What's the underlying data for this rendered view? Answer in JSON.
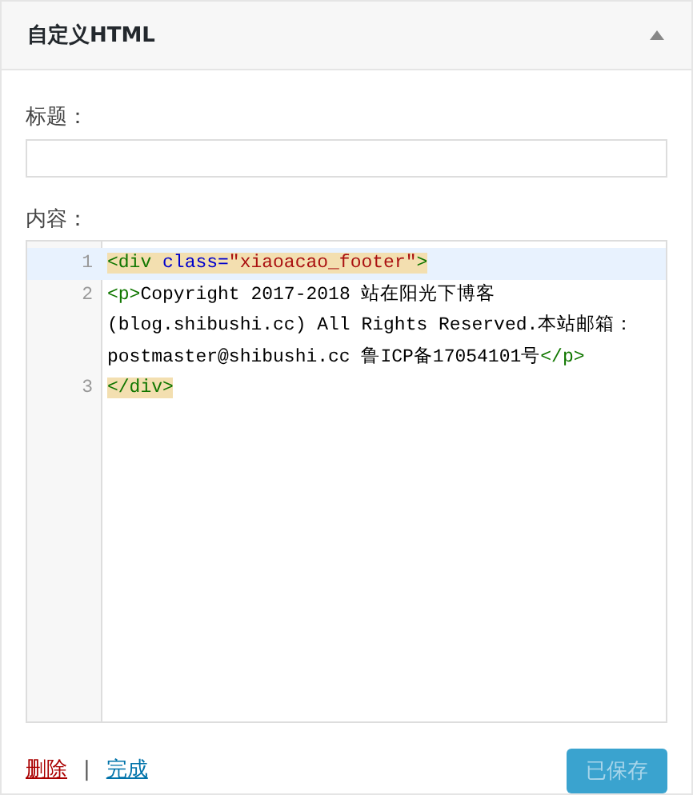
{
  "widget": {
    "title": "自定义HTML",
    "expanded": true
  },
  "title_field": {
    "label": "标题："
  },
  "content_label": "内容：",
  "code_lines": [
    {
      "number": "1",
      "active": true,
      "segments": [
        {
          "kind": "tag",
          "text": "<div",
          "matched": true
        },
        {
          "kind": "attr",
          "text": " class=",
          "matched": true
        },
        {
          "kind": "string",
          "text": "\"xiaoacao_footer\"",
          "matched": true
        },
        {
          "kind": "tag",
          "text": ">",
          "matched": true
        }
      ]
    },
    {
      "number": "2",
      "active": false,
      "segments": [
        {
          "kind": "tag",
          "text": "<p>",
          "matched": false
        },
        {
          "kind": "text",
          "text": "Copyright 2017-2018 站在阳光下博客 (blog.shibushi.cc) All Rights Reserved.本站邮箱：postmaster@shibushi.cc 鲁ICP备17054101号",
          "matched": false
        },
        {
          "kind": "tag",
          "text": "</p>",
          "matched": false
        }
      ]
    },
    {
      "number": "3",
      "active": false,
      "segments": [
        {
          "kind": "tag",
          "text": "</div>",
          "matched": true
        }
      ]
    }
  ],
  "actions": {
    "delete": "删除",
    "separator": "|",
    "done": "完成",
    "save": "已保存",
    "save_disabled": true
  }
}
